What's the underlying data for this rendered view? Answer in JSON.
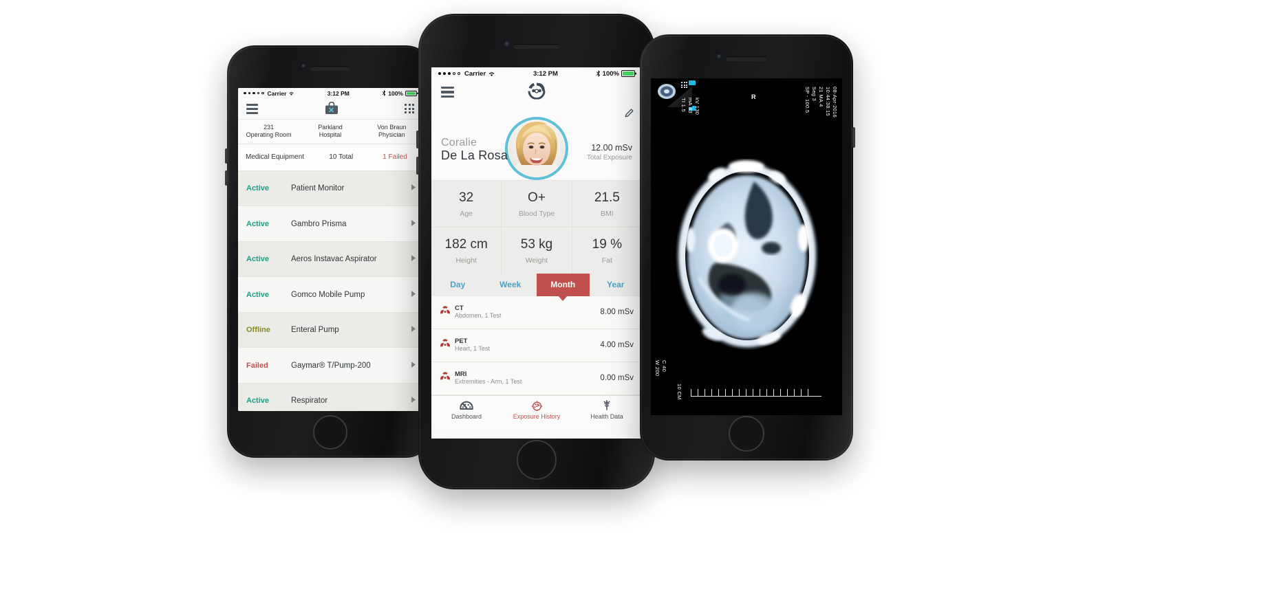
{
  "left_phone": {
    "status_bar": {
      "carrier": "Carrier",
      "time": "3:12 PM",
      "battery": "100%"
    },
    "nav": {
      "menu_icon": "hamburger-menu-icon",
      "title_icon": "toolbox-icon",
      "grid_icon": "grid-menu-icon"
    },
    "info_bar": [
      {
        "value": "231",
        "label": "Operating Room"
      },
      {
        "value": "Parkland",
        "label": "Hospital"
      },
      {
        "value": "Von Braun",
        "label": "Physician"
      }
    ],
    "summary": {
      "title": "Medical Equipment",
      "total": "10 Total",
      "failed": "1 Failed"
    },
    "equipment": [
      {
        "status": "Active",
        "name": "Patient Monitor"
      },
      {
        "status": "Active",
        "name": "Gambro Prisma"
      },
      {
        "status": "Active",
        "name": "Aeros Instavac Aspirator"
      },
      {
        "status": "Active",
        "name": "Gomco Mobile Pump"
      },
      {
        "status": "Offline",
        "name": "Enteral Pump"
      },
      {
        "status": "Failed",
        "name": "Gaymar® T/Pump-200"
      },
      {
        "status": "Active",
        "name": "Respirator"
      }
    ]
  },
  "center_phone": {
    "status_bar": {
      "carrier": "Carrier",
      "time": "3:12 PM",
      "battery": "100%"
    },
    "nav": {
      "menu_icon": "hamburger-menu-icon",
      "logo_icon": "radiation-face-logo-icon",
      "edit_icon": "pencil-edit-icon"
    },
    "patient": {
      "first_name": "Coralie",
      "last_name": "De La Rosa",
      "avatar": "patient-photo",
      "exposure_value": "12.00 mSv",
      "exposure_label": "Total Exposure"
    },
    "stats": [
      {
        "value": "32",
        "label": "Age"
      },
      {
        "value": "O+",
        "label": "Blood Type"
      },
      {
        "value": "21.5",
        "label": "BMI"
      },
      {
        "value": "182 cm",
        "label": "Height"
      },
      {
        "value": "53 kg",
        "label": "Weight"
      },
      {
        "value": "19 %",
        "label": "Fat"
      }
    ],
    "period_tabs": [
      {
        "label": "Day",
        "selected": false
      },
      {
        "label": "Week",
        "selected": false
      },
      {
        "label": "Month",
        "selected": true
      },
      {
        "label": "Year",
        "selected": false
      }
    ],
    "exposure_history": [
      {
        "type": "CT",
        "detail": "Abdomen, 1 Test",
        "dose": "8.00 mSv"
      },
      {
        "type": "PET",
        "detail": "Heart, 1 Test",
        "dose": "4.00 mSv"
      },
      {
        "type": "MRI",
        "detail": "Extremities - Arm, 1 Test",
        "dose": "0.00 mSv"
      }
    ],
    "tab_bar": [
      {
        "label": "Dashboard",
        "icon": "dashboard-gauge-icon",
        "selected": false
      },
      {
        "label": "Exposure History",
        "icon": "radiation-clock-icon",
        "selected": true
      },
      {
        "label": "Health Data",
        "icon": "caduceus-icon",
        "selected": false
      }
    ]
  },
  "right_phone": {
    "scan": {
      "image": "ct-head-axial-scan",
      "orientation_marker": "R",
      "overlay_left": [
        "kV 130",
        "mA 83",
        "TI 1.5"
      ],
      "overlay_right": [
        "08-Apr-2016",
        "10:44:38:15",
        "21 MA 4",
        "Seg 3",
        "SP - 100.5"
      ],
      "overlay_bottom_left": [
        "W 200",
        "C 40"
      ],
      "scale_label": "10 CM"
    }
  },
  "colors": {
    "accent_red": "#c0504d",
    "accent_teal": "#16a085",
    "accent_blue": "#4aa3c4",
    "accent_olive": "#8a8b1e",
    "avatar_ring": "#5bc0d8",
    "battery_green": "#4cd964"
  }
}
